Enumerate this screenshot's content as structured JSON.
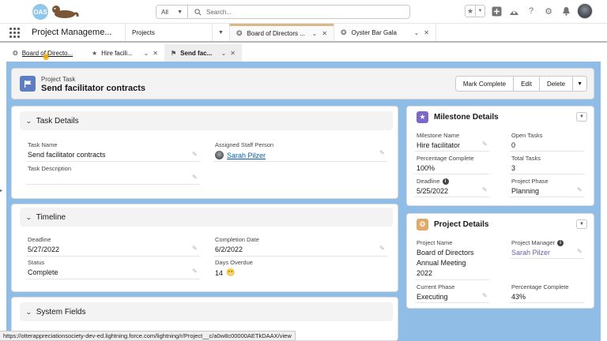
{
  "header": {
    "logo_text": "OAS",
    "search": {
      "scope": "All",
      "placeholder": "Search..."
    }
  },
  "nav": {
    "app_name": "Project Manageme...",
    "items": [
      {
        "label": "Projects"
      },
      {
        "label": "Board of Directors ..."
      },
      {
        "label": "Oyster Bar Gala"
      }
    ]
  },
  "subtabs": [
    {
      "label": "Board of Directo..."
    },
    {
      "label": "Hire facili..."
    },
    {
      "label": "Send fac..."
    }
  ],
  "record": {
    "type": "Project Task",
    "title": "Send facilitator contracts",
    "actions": {
      "mark_complete": "Mark Complete",
      "edit": "Edit",
      "delete": "Delete"
    }
  },
  "task_details": {
    "heading": "Task Details",
    "task_name_label": "Task Name",
    "task_name": "Send facilitator contracts",
    "assigned_label": "Assigned Staff Person",
    "assigned": "Sarah Pilzer",
    "description_label": "Task Description",
    "description": ""
  },
  "timeline": {
    "heading": "Timeline",
    "deadline_label": "Deadline",
    "deadline": "5/27/2022",
    "completion_label": "Completion Date",
    "completion": "6/2/2022",
    "status_label": "Status",
    "status": "Complete",
    "overdue_label": "Days Overdue",
    "overdue": "14",
    "overdue_emoji": "😬"
  },
  "system_fields": {
    "heading": "System Fields"
  },
  "milestone": {
    "heading": "Milestone Details",
    "name_label": "Milestone Name",
    "name": "Hire facilitator",
    "open_tasks_label": "Open Tasks",
    "open_tasks": "0",
    "pct_label": "Percentage Complete",
    "pct": "100%",
    "total_tasks_label": "Total Tasks",
    "total_tasks": "3",
    "deadline_label": "Deadline",
    "deadline": "5/25/2022",
    "phase_label": "Project Phase",
    "phase": "Planning"
  },
  "project": {
    "heading": "Project Details",
    "name_label": "Project Name",
    "name_line1": "Board of Directors",
    "name_line2": "Annual Meeting",
    "name_line3": "2022",
    "manager_label": "Project Manager",
    "manager": "Sarah Pilzer",
    "phase_label": "Current Phase",
    "phase": "Executing",
    "pct_label": "Percentage Complete",
    "pct": "43%"
  },
  "status_url": "https://otterappreciationsociety-dev-ed.lightning.force.com/lightning/r/Project__c/a0w8c00000AETkDAAX/view",
  "colors": {
    "workspace_bg": "#8fbde6",
    "task_icon": "#5d7ec2",
    "milestone_icon": "#7b68c8",
    "project_icon": "#e0a96a",
    "link": "#0b5cab"
  }
}
